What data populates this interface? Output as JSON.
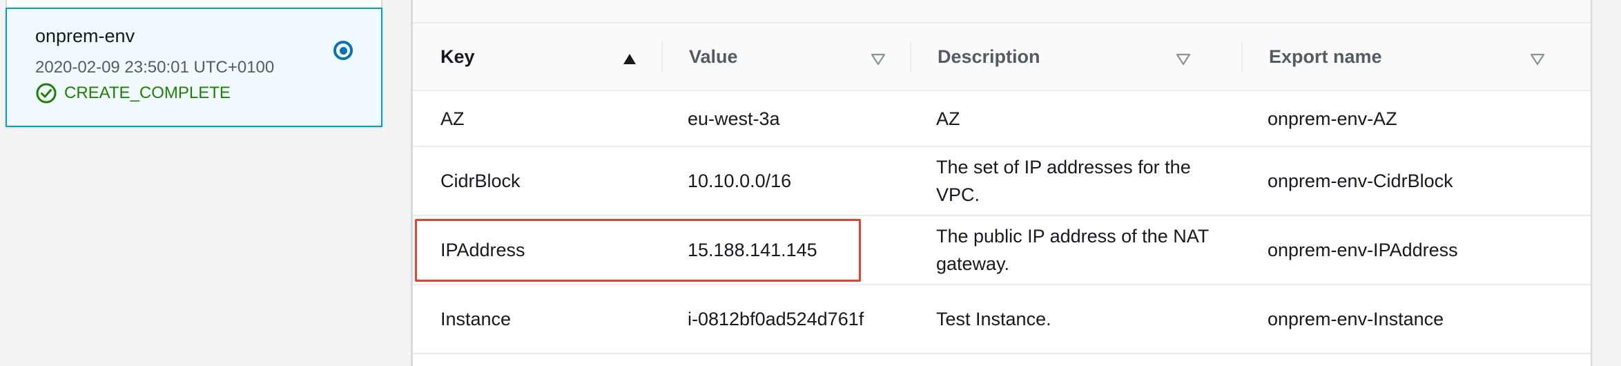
{
  "stack": {
    "name": "onprem-env",
    "timestamp": "2020-02-09 23:50:01 UTC+0100",
    "status": "CREATE_COMPLETE",
    "status_color": "#1d8102",
    "status_icon": "check-circle-icon",
    "selected": true
  },
  "outputs_table": {
    "columns": [
      {
        "label": "Key",
        "sort": "ascending",
        "sort_icon": "sort-ascending-icon"
      },
      {
        "label": "Value",
        "sort": "none",
        "sort_icon": "sort-descending-outline-icon"
      },
      {
        "label": "Description",
        "sort": "none",
        "sort_icon": "sort-descending-outline-icon"
      },
      {
        "label": "Export name",
        "sort": "none",
        "sort_icon": "sort-descending-outline-icon"
      }
    ],
    "rows": [
      {
        "key": "AZ",
        "value": "eu-west-3a",
        "description": "AZ",
        "export_name": "onprem-env-AZ"
      },
      {
        "key": "CidrBlock",
        "value": "10.10.0.0/16",
        "description": "The set of IP addresses for the VPC.",
        "export_name": "onprem-env-CidrBlock"
      },
      {
        "key": "IPAddress",
        "value": "15.188.141.145",
        "description": "The public IP address of the NAT gateway.",
        "export_name": "onprem-env-IPAddress"
      },
      {
        "key": "Instance",
        "value": "i-0812bf0ad524d761f",
        "description": "Test Instance.",
        "export_name": "onprem-env-Instance"
      }
    ],
    "highlighted_row_key": "IPAddress",
    "highlight_color": "#e2452b"
  },
  "colors": {
    "accent": "#0073bb",
    "selected_border": "#00a1c9",
    "selected_bg": "#f1faff"
  }
}
